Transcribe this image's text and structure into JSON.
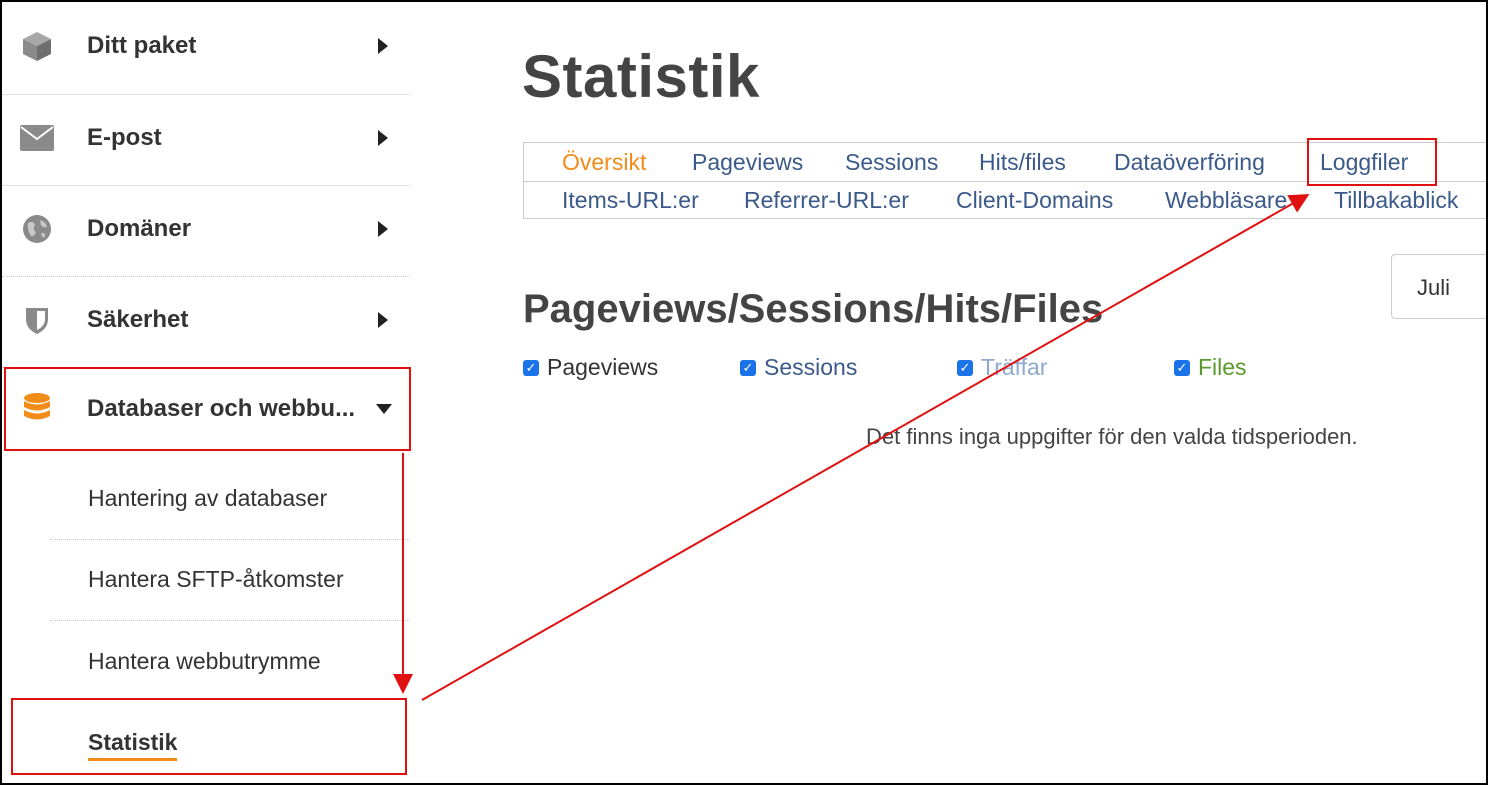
{
  "sidebar": {
    "items": [
      {
        "label": "Ditt paket",
        "icon": "package-icon"
      },
      {
        "label": "E-post",
        "icon": "envelope-icon"
      },
      {
        "label": "Domäner",
        "icon": "globe-icon"
      },
      {
        "label": "Säkerhet",
        "icon": "shield-icon"
      },
      {
        "label": "Databaser och webbu...",
        "icon": "database-icon"
      }
    ],
    "subitems": [
      {
        "label": "Hantering av databaser"
      },
      {
        "label": "Hantera SFTP-åtkomster"
      },
      {
        "label": "Hantera webbutrymme"
      },
      {
        "label": "Statistik"
      }
    ]
  },
  "main": {
    "title": "Statistik",
    "tabs_row1": [
      "Översikt",
      "Pageviews",
      "Sessions",
      "Hits/files",
      "Dataöverföring",
      "Loggfiler"
    ],
    "tabs_row2": [
      "Items-URL:er",
      "Referrer-URL:er",
      "Client-Domains",
      "Webbläsare",
      "Tillbakablick"
    ],
    "month": "Juli",
    "section_title": "Pageviews/Sessions/Hits/Files",
    "checkboxes": [
      {
        "label": "Pageviews",
        "color": "#333333"
      },
      {
        "label": "Sessions",
        "color": "#3b5a8a"
      },
      {
        "label": "Träffar",
        "color": "#8fa8cc"
      },
      {
        "label": "Files",
        "color": "#5a9a2a"
      }
    ],
    "empty_message": "Det finns inga uppgifter för den valda tidsperioden."
  },
  "colors": {
    "accent": "#f28c18",
    "link": "#3b5a8a",
    "highlight": "#e01010"
  }
}
